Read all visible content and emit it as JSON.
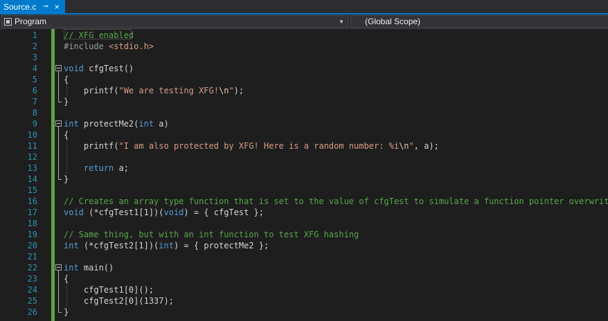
{
  "tab": {
    "title": "Source.c",
    "pin_glyph": "⊸",
    "close_glyph": "×"
  },
  "nav": {
    "left_scope": "Program",
    "right_scope": "(Global Scope)"
  },
  "colors": {
    "accent": "#007acc",
    "keyword": "#569cd6",
    "comment": "#57a64a",
    "string": "#d69d85",
    "line_number": "#2b91af",
    "change_bar": "#57a64a"
  },
  "code": {
    "line_numbers": [
      "1",
      "2",
      "3",
      "4",
      "5",
      "6",
      "7",
      "8",
      "9",
      "10",
      "11",
      "12",
      "13",
      "14",
      "15",
      "16",
      "17",
      "18",
      "19",
      "20",
      "21",
      "22",
      "23",
      "24",
      "25",
      "26"
    ],
    "lines": [
      [
        {
          "t": "// XFG enabled",
          "c": "cm"
        }
      ],
      [
        {
          "t": "#include ",
          "c": "pp"
        },
        {
          "t": "<stdio.h>",
          "c": "str"
        }
      ],
      [],
      [
        {
          "t": "void",
          "c": "kw"
        },
        {
          "t": " cfgTest()",
          "c": ""
        }
      ],
      [
        {
          "t": "{",
          "c": ""
        }
      ],
      [
        {
          "t": "    printf(",
          "c": ""
        },
        {
          "t": "\"We are testing XFG!",
          "c": "str"
        },
        {
          "t": "\\n",
          "c": "esc"
        },
        {
          "t": "\"",
          "c": "str"
        },
        {
          "t": ");",
          "c": ""
        }
      ],
      [
        {
          "t": "}",
          "c": ""
        }
      ],
      [],
      [
        {
          "t": "int",
          "c": "kw"
        },
        {
          "t": " protectMe2(",
          "c": ""
        },
        {
          "t": "int",
          "c": "kw"
        },
        {
          "t": " a)",
          "c": ""
        }
      ],
      [
        {
          "t": "{",
          "c": ""
        }
      ],
      [
        {
          "t": "    printf(",
          "c": ""
        },
        {
          "t": "\"I am also protected by XFG! Here is a random number: %i",
          "c": "str"
        },
        {
          "t": "\\n",
          "c": "esc"
        },
        {
          "t": "\"",
          "c": "str"
        },
        {
          "t": ", a);",
          "c": ""
        }
      ],
      [],
      [
        {
          "t": "    ",
          "c": ""
        },
        {
          "t": "return",
          "c": "kw"
        },
        {
          "t": " a;",
          "c": ""
        }
      ],
      [
        {
          "t": "}",
          "c": ""
        }
      ],
      [],
      [
        {
          "t": "// Creates an array type function that is set to the value of cfgTest to simulate a function pointer overwrite",
          "c": "cm"
        }
      ],
      [
        {
          "t": "void",
          "c": "kw"
        },
        {
          "t": " (*cfgTest1[1])(",
          "c": ""
        },
        {
          "t": "void",
          "c": "kw"
        },
        {
          "t": ") = { cfgTest };",
          "c": ""
        }
      ],
      [],
      [
        {
          "t": "// Same thing, but with an int function to test XFG hashing",
          "c": "cm"
        }
      ],
      [
        {
          "t": "int",
          "c": "kw"
        },
        {
          "t": " (*cfgTest2[1])(",
          "c": ""
        },
        {
          "t": "int",
          "c": "kw"
        },
        {
          "t": ") = { protectMe2 };",
          "c": ""
        }
      ],
      [],
      [
        {
          "t": "int",
          "c": "kw"
        },
        {
          "t": " main()",
          "c": ""
        }
      ],
      [
        {
          "t": "{",
          "c": ""
        }
      ],
      [
        {
          "t": "    cfgTest1[0]();",
          "c": ""
        }
      ],
      [
        {
          "t": "    cfgTest2[0](1337);",
          "c": ""
        }
      ],
      [
        {
          "t": "}",
          "c": ""
        }
      ]
    ]
  }
}
